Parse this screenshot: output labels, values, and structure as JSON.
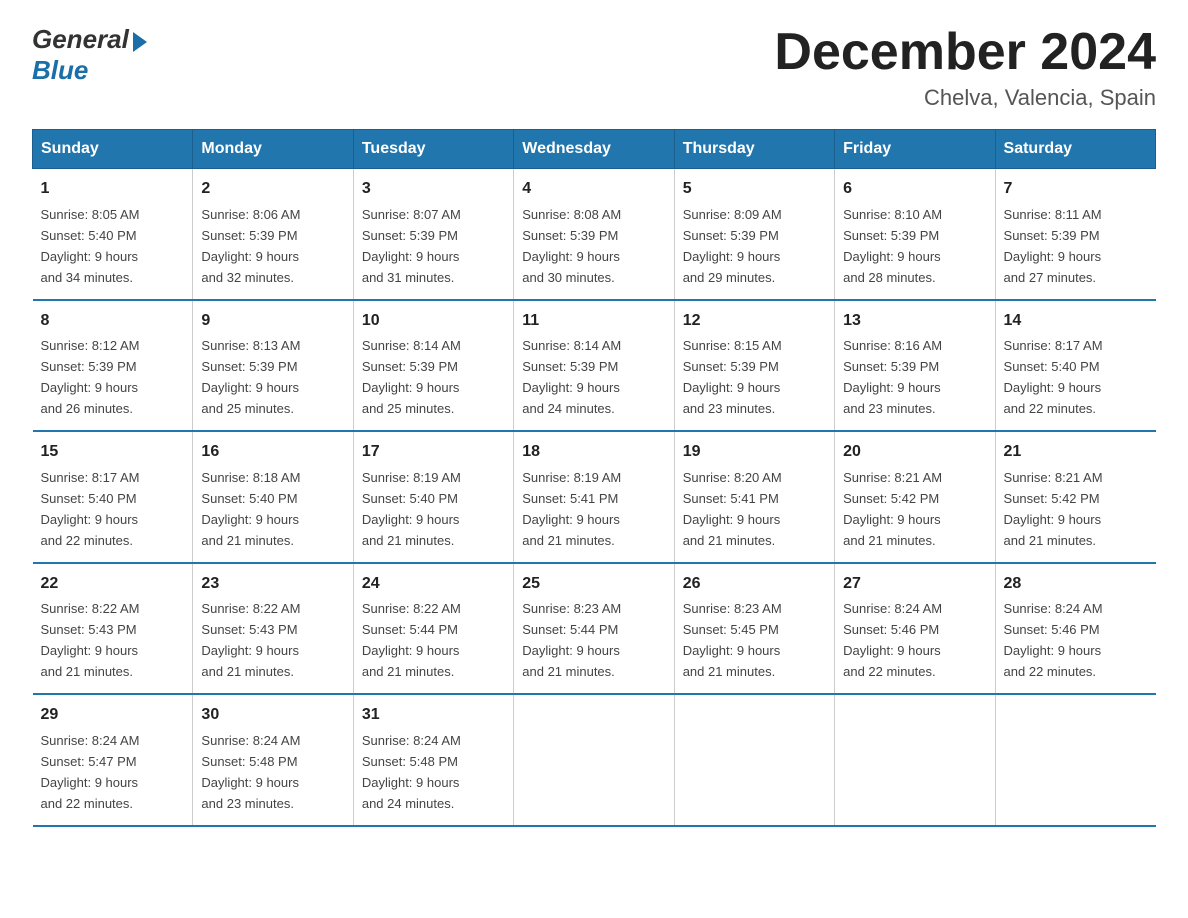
{
  "logo": {
    "general": "General",
    "blue": "Blue"
  },
  "header": {
    "title": "December 2024",
    "location": "Chelva, Valencia, Spain"
  },
  "days_of_week": [
    "Sunday",
    "Monday",
    "Tuesday",
    "Wednesday",
    "Thursday",
    "Friday",
    "Saturday"
  ],
  "weeks": [
    [
      {
        "num": "1",
        "sunrise": "8:05 AM",
        "sunset": "5:40 PM",
        "daylight": "9 hours and 34 minutes."
      },
      {
        "num": "2",
        "sunrise": "8:06 AM",
        "sunset": "5:39 PM",
        "daylight": "9 hours and 32 minutes."
      },
      {
        "num": "3",
        "sunrise": "8:07 AM",
        "sunset": "5:39 PM",
        "daylight": "9 hours and 31 minutes."
      },
      {
        "num": "4",
        "sunrise": "8:08 AM",
        "sunset": "5:39 PM",
        "daylight": "9 hours and 30 minutes."
      },
      {
        "num": "5",
        "sunrise": "8:09 AM",
        "sunset": "5:39 PM",
        "daylight": "9 hours and 29 minutes."
      },
      {
        "num": "6",
        "sunrise": "8:10 AM",
        "sunset": "5:39 PM",
        "daylight": "9 hours and 28 minutes."
      },
      {
        "num": "7",
        "sunrise": "8:11 AM",
        "sunset": "5:39 PM",
        "daylight": "9 hours and 27 minutes."
      }
    ],
    [
      {
        "num": "8",
        "sunrise": "8:12 AM",
        "sunset": "5:39 PM",
        "daylight": "9 hours and 26 minutes."
      },
      {
        "num": "9",
        "sunrise": "8:13 AM",
        "sunset": "5:39 PM",
        "daylight": "9 hours and 25 minutes."
      },
      {
        "num": "10",
        "sunrise": "8:14 AM",
        "sunset": "5:39 PM",
        "daylight": "9 hours and 25 minutes."
      },
      {
        "num": "11",
        "sunrise": "8:14 AM",
        "sunset": "5:39 PM",
        "daylight": "9 hours and 24 minutes."
      },
      {
        "num": "12",
        "sunrise": "8:15 AM",
        "sunset": "5:39 PM",
        "daylight": "9 hours and 23 minutes."
      },
      {
        "num": "13",
        "sunrise": "8:16 AM",
        "sunset": "5:39 PM",
        "daylight": "9 hours and 23 minutes."
      },
      {
        "num": "14",
        "sunrise": "8:17 AM",
        "sunset": "5:40 PM",
        "daylight": "9 hours and 22 minutes."
      }
    ],
    [
      {
        "num": "15",
        "sunrise": "8:17 AM",
        "sunset": "5:40 PM",
        "daylight": "9 hours and 22 minutes."
      },
      {
        "num": "16",
        "sunrise": "8:18 AM",
        "sunset": "5:40 PM",
        "daylight": "9 hours and 21 minutes."
      },
      {
        "num": "17",
        "sunrise": "8:19 AM",
        "sunset": "5:40 PM",
        "daylight": "9 hours and 21 minutes."
      },
      {
        "num": "18",
        "sunrise": "8:19 AM",
        "sunset": "5:41 PM",
        "daylight": "9 hours and 21 minutes."
      },
      {
        "num": "19",
        "sunrise": "8:20 AM",
        "sunset": "5:41 PM",
        "daylight": "9 hours and 21 minutes."
      },
      {
        "num": "20",
        "sunrise": "8:21 AM",
        "sunset": "5:42 PM",
        "daylight": "9 hours and 21 minutes."
      },
      {
        "num": "21",
        "sunrise": "8:21 AM",
        "sunset": "5:42 PM",
        "daylight": "9 hours and 21 minutes."
      }
    ],
    [
      {
        "num": "22",
        "sunrise": "8:22 AM",
        "sunset": "5:43 PM",
        "daylight": "9 hours and 21 minutes."
      },
      {
        "num": "23",
        "sunrise": "8:22 AM",
        "sunset": "5:43 PM",
        "daylight": "9 hours and 21 minutes."
      },
      {
        "num": "24",
        "sunrise": "8:22 AM",
        "sunset": "5:44 PM",
        "daylight": "9 hours and 21 minutes."
      },
      {
        "num": "25",
        "sunrise": "8:23 AM",
        "sunset": "5:44 PM",
        "daylight": "9 hours and 21 minutes."
      },
      {
        "num": "26",
        "sunrise": "8:23 AM",
        "sunset": "5:45 PM",
        "daylight": "9 hours and 21 minutes."
      },
      {
        "num": "27",
        "sunrise": "8:24 AM",
        "sunset": "5:46 PM",
        "daylight": "9 hours and 22 minutes."
      },
      {
        "num": "28",
        "sunrise": "8:24 AM",
        "sunset": "5:46 PM",
        "daylight": "9 hours and 22 minutes."
      }
    ],
    [
      {
        "num": "29",
        "sunrise": "8:24 AM",
        "sunset": "5:47 PM",
        "daylight": "9 hours and 22 minutes."
      },
      {
        "num": "30",
        "sunrise": "8:24 AM",
        "sunset": "5:48 PM",
        "daylight": "9 hours and 23 minutes."
      },
      {
        "num": "31",
        "sunrise": "8:24 AM",
        "sunset": "5:48 PM",
        "daylight": "9 hours and 24 minutes."
      },
      null,
      null,
      null,
      null
    ]
  ],
  "labels": {
    "sunrise_prefix": "Sunrise: ",
    "sunset_prefix": "Sunset: ",
    "daylight_prefix": "Daylight: "
  }
}
